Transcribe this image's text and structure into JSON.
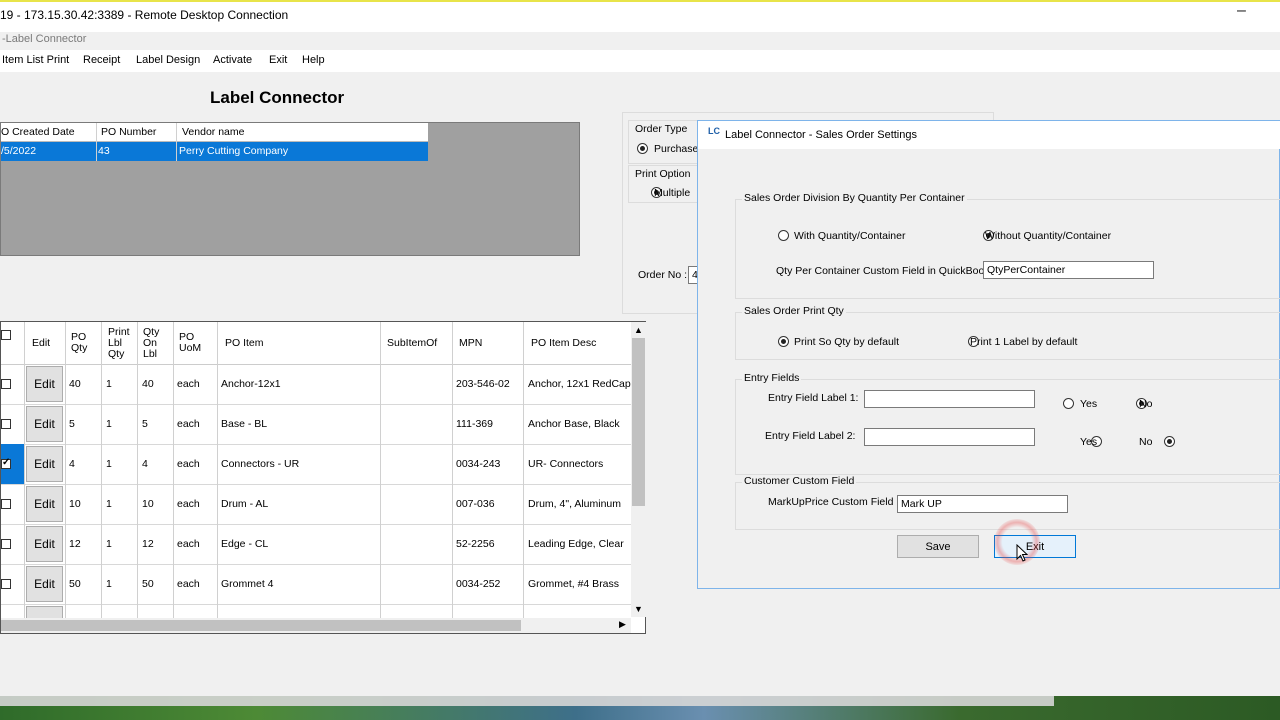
{
  "rdp": {
    "title": "19 - 173.15.30.42:3389 - Remote Desktop Connection",
    "minimize_glyph": "–"
  },
  "app": {
    "title": "-Label Connector",
    "heading": "Label Connector"
  },
  "menu": [
    "Item List Print",
    "Receipt",
    "Label Design",
    "Activate",
    "Exit",
    "Help"
  ],
  "po_grid": {
    "headers": [
      "O Created Date",
      "PO Number",
      "Vendor name"
    ],
    "rows": [
      {
        "date": "/5/2022",
        "po": "43",
        "vendor": "Perry Cutting Company"
      }
    ]
  },
  "order_panel": {
    "order_type_label": "Order Type",
    "order_type_value": "Purchase",
    "print_option_label": "Print Option",
    "print_option_value": "Multiple",
    "order_no_label": "Order No :",
    "order_no_value": "4"
  },
  "item_grid": {
    "headers": {
      "edit": "Edit",
      "po_qty": "PO Qty",
      "print_qty": "Print Lbl Qty",
      "qty_on": "Qty On Lbl",
      "uom": "PO UoM",
      "item": "PO Item",
      "subitem": "SubItemOf",
      "mpn": "MPN",
      "desc": "PO Item Desc"
    },
    "rows": [
      {
        "checked": false,
        "edit": "Edit",
        "po_qty": "40",
        "print_qty": "1",
        "qty_on": "40",
        "uom": "each",
        "item": "Anchor-12x1",
        "subitem": "",
        "mpn": "203-546-02",
        "desc": "Anchor, 12x1 RedCap"
      },
      {
        "checked": false,
        "edit": "Edit",
        "po_qty": "5",
        "print_qty": "1",
        "qty_on": "5",
        "uom": "each",
        "item": "Base - BL",
        "subitem": "",
        "mpn": "111-369",
        "desc": "Anchor Base, Black"
      },
      {
        "checked": true,
        "edit": "Edit",
        "po_qty": "4",
        "print_qty": "1",
        "qty_on": "4",
        "uom": "each",
        "item": "Connectors - UR",
        "subitem": "",
        "mpn": "0034-243",
        "desc": "UR- Connectors"
      },
      {
        "checked": false,
        "edit": "Edit",
        "po_qty": "10",
        "print_qty": "1",
        "qty_on": "10",
        "uom": "each",
        "item": "Drum - AL",
        "subitem": "",
        "mpn": "007-036",
        "desc": "Drum, 4\", Aluminum"
      },
      {
        "checked": false,
        "edit": "Edit",
        "po_qty": "12",
        "print_qty": "1",
        "qty_on": "12",
        "uom": "each",
        "item": "Edge - CL",
        "subitem": "",
        "mpn": "52-2256",
        "desc": "Leading Edge, Clear"
      },
      {
        "checked": false,
        "edit": "Edit",
        "po_qty": "50",
        "print_qty": "1",
        "qty_on": "50",
        "uom": "each",
        "item": "Grommet 4",
        "subitem": "",
        "mpn": "0034-252",
        "desc": "Grommet, #4 Brass"
      }
    ]
  },
  "dialog": {
    "icon_text": "LC",
    "title": "Label Connector - Sales Order Settings",
    "division": {
      "legend": "Sales Order Division By Quantity Per Container",
      "opt_with": "With Quantity/Container",
      "opt_without": "Without Quantity/Container",
      "selected": "without",
      "custom_field_label": "Qty Per Container Custom Field in QuickBooks:",
      "custom_field_value": "QtyPerContainer"
    },
    "print_qty": {
      "legend": "Sales Order Print Qty",
      "opt_so": "Print So Qty by default",
      "opt_one": "Print 1 Label by default",
      "selected": "so"
    },
    "entry": {
      "legend": "Entry Fields",
      "label1": "Entry Field Label 1:",
      "label2": "Entry  Field Label 2:",
      "value1": "",
      "value2": "",
      "yes": "Yes",
      "no": "No"
    },
    "customer": {
      "legend": "Customer  Custom Field",
      "markup_label": "MarkUpPrice Custom Field",
      "markup_value": "Mark UP"
    },
    "save_label": "Save",
    "exit_label": "Exit"
  }
}
